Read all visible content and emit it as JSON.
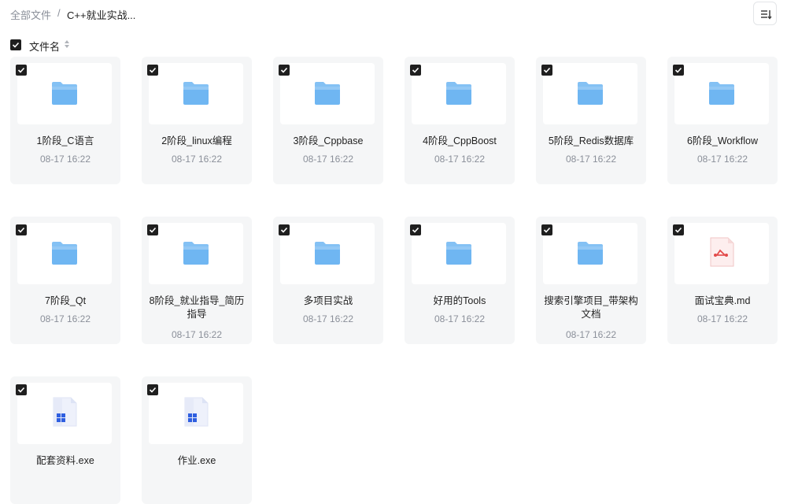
{
  "breadcrumb": {
    "root": "全部文件",
    "separator": "/",
    "current": "C++就业实战..."
  },
  "toolbar": {
    "sort_icon": "sort-list-icon"
  },
  "list_header": {
    "column_label": "文件名",
    "select_all_checked": true
  },
  "colors": {
    "card_bg": "#f5f6f7",
    "folder": "#6fb6f2",
    "md_red": "#e34a4a",
    "exe_blue": "#2f5fe0",
    "checkbox": "#1f1f1f"
  },
  "files": [
    {
      "name": "1阶段_C语言",
      "date": "08-17 16:22",
      "type": "folder",
      "checked": true
    },
    {
      "name": "2阶段_linux编程",
      "date": "08-17 16:22",
      "type": "folder",
      "checked": true
    },
    {
      "name": "3阶段_Cppbase",
      "date": "08-17 16:22",
      "type": "folder",
      "checked": true
    },
    {
      "name": "4阶段_CppBoost",
      "date": "08-17 16:22",
      "type": "folder",
      "checked": true
    },
    {
      "name": "5阶段_Redis数据库",
      "date": "08-17 16:22",
      "type": "folder",
      "checked": true
    },
    {
      "name": "6阶段_Workflow",
      "date": "08-17 16:22",
      "type": "folder",
      "checked": true
    },
    {
      "name": "7阶段_Qt",
      "date": "08-17 16:22",
      "type": "folder",
      "checked": true
    },
    {
      "name": "8阶段_就业指导_简历指导",
      "date": "08-17 16:22",
      "type": "folder",
      "checked": true
    },
    {
      "name": "多项目实战",
      "date": "08-17 16:22",
      "type": "folder",
      "checked": true
    },
    {
      "name": "好用的Tools",
      "date": "08-17 16:22",
      "type": "folder",
      "checked": true
    },
    {
      "name": "搜索引擎项目_带架构文档",
      "date": "08-17 16:22",
      "type": "folder",
      "checked": true
    },
    {
      "name": "面试宝典.md",
      "date": "08-17 16:22",
      "type": "md",
      "checked": true
    },
    {
      "name": "配套资料.exe",
      "date": "",
      "type": "exe",
      "checked": true
    },
    {
      "name": "作业.exe",
      "date": "",
      "type": "exe",
      "checked": true
    }
  ]
}
